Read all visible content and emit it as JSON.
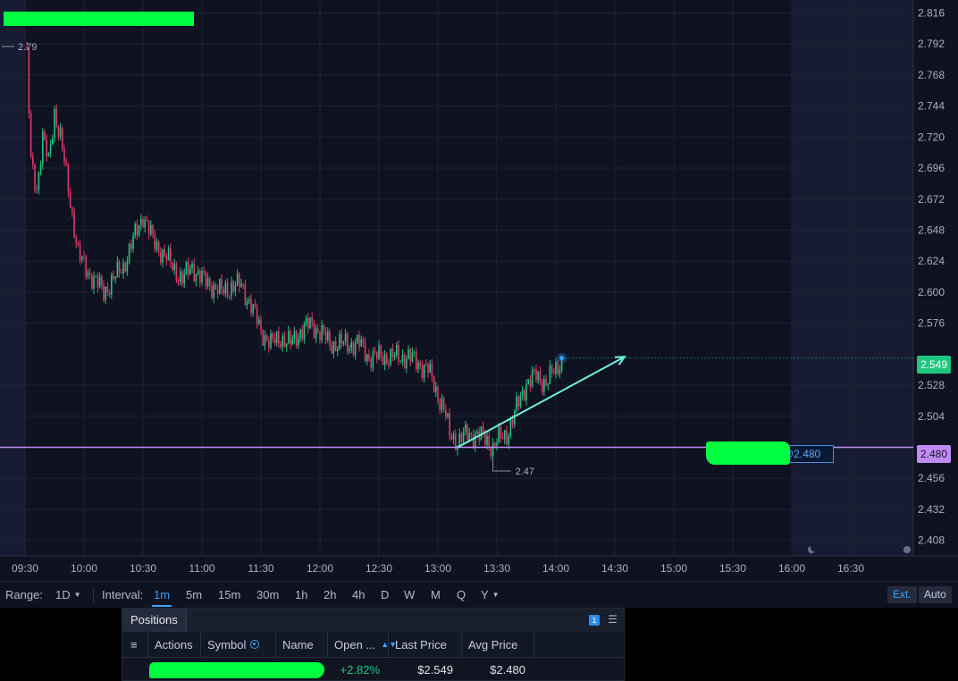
{
  "chart": {
    "y_ticks": [
      "2.816",
      "2.792",
      "2.768",
      "2.744",
      "2.720",
      "2.696",
      "2.672",
      "2.648",
      "2.624",
      "2.600",
      "2.576",
      "2.528",
      "2.504",
      "2.456",
      "2.432",
      "2.408"
    ],
    "x_ticks": [
      "09:30",
      "10:00",
      "10:30",
      "11:00",
      "11:30",
      "12:00",
      "12:30",
      "13:00",
      "13:30",
      "14:00",
      "14:30",
      "15:00",
      "15:30",
      "16:00",
      "16:30"
    ],
    "high_label": "2.79",
    "low_label": "2.47",
    "last_price_label": "2.549",
    "avg_price_label": "2.480",
    "position_tag_label": "@2.480",
    "colors": {
      "up": "#1fc77e",
      "down": "#e0396a",
      "avg_line": "#c18cf5",
      "trend": "#6ef2e0"
    }
  },
  "chart_data": {
    "type": "candlestick",
    "ylim": [
      2.396,
      2.826
    ],
    "x_range": [
      "09:30",
      "16:30"
    ],
    "high": 2.79,
    "low": 2.47,
    "last_price": 2.549,
    "avg_price": 2.48,
    "path": [
      [
        "09:30",
        2.79
      ],
      [
        "09:31",
        2.78
      ],
      [
        "09:33",
        2.7
      ],
      [
        "09:36",
        2.68
      ],
      [
        "09:39",
        2.72
      ],
      [
        "09:42",
        2.7
      ],
      [
        "09:45",
        2.74
      ],
      [
        "09:48",
        2.72
      ],
      [
        "09:51",
        2.69
      ],
      [
        "09:54",
        2.66
      ],
      [
        "09:57",
        2.63
      ],
      [
        "10:00",
        2.62
      ],
      [
        "10:05",
        2.61
      ],
      [
        "10:10",
        2.6
      ],
      [
        "10:15",
        2.61
      ],
      [
        "10:20",
        2.62
      ],
      [
        "10:25",
        2.64
      ],
      [
        "10:30",
        2.66
      ],
      [
        "10:35",
        2.64
      ],
      [
        "10:40",
        2.63
      ],
      [
        "10:45",
        2.62
      ],
      [
        "10:50",
        2.61
      ],
      [
        "10:55",
        2.62
      ],
      [
        "11:00",
        2.61
      ],
      [
        "11:05",
        2.605
      ],
      [
        "11:10",
        2.6
      ],
      [
        "11:15",
        2.605
      ],
      [
        "11:20",
        2.605
      ],
      [
        "11:25",
        2.59
      ],
      [
        "11:30",
        2.57
      ],
      [
        "11:35",
        2.56
      ],
      [
        "11:40",
        2.565
      ],
      [
        "11:45",
        2.56
      ],
      [
        "11:50",
        2.57
      ],
      [
        "11:55",
        2.575
      ],
      [
        "12:00",
        2.57
      ],
      [
        "12:05",
        2.56
      ],
      [
        "12:10",
        2.56
      ],
      [
        "12:15",
        2.56
      ],
      [
        "12:20",
        2.56
      ],
      [
        "12:25",
        2.55
      ],
      [
        "12:30",
        2.55
      ],
      [
        "12:35",
        2.55
      ],
      [
        "12:40",
        2.55
      ],
      [
        "12:45",
        2.55
      ],
      [
        "12:50",
        2.545
      ],
      [
        "12:55",
        2.54
      ],
      [
        "13:00",
        2.52
      ],
      [
        "13:03",
        2.51
      ],
      [
        "13:06",
        2.49
      ],
      [
        "13:10",
        2.485
      ],
      [
        "13:15",
        2.49
      ],
      [
        "13:20",
        2.49
      ],
      [
        "13:25",
        2.485
      ],
      [
        "13:28",
        2.48
      ],
      [
        "13:30",
        2.485
      ],
      [
        "13:35",
        2.49
      ],
      [
        "13:40",
        2.51
      ],
      [
        "13:45",
        2.53
      ],
      [
        "13:50",
        2.535
      ],
      [
        "13:55",
        2.53
      ],
      [
        "14:00",
        2.54
      ],
      [
        "14:03",
        2.549
      ]
    ],
    "trend_arrow": {
      "from": [
        "13:10",
        2.48
      ],
      "to": [
        "14:35",
        2.55
      ]
    }
  },
  "controls": {
    "range_label": "Range:",
    "range_value": "1D",
    "interval_label": "Interval:",
    "intervals": [
      "1m",
      "5m",
      "15m",
      "30m",
      "1h",
      "2h",
      "4h",
      "D",
      "W",
      "M",
      "Q",
      "Y"
    ],
    "selected_interval": "1m",
    "ext_label": "Ext.",
    "auto_label": "Auto"
  },
  "positions": {
    "tab_label": "Positions",
    "count": "1",
    "columns": [
      "Actions",
      "Symbol",
      "Name",
      "Open ...",
      "Last Price",
      "Avg Price"
    ],
    "row": {
      "open_pl": "+2.82%",
      "last_price": "$2.549",
      "avg_price": "$2.480"
    }
  }
}
